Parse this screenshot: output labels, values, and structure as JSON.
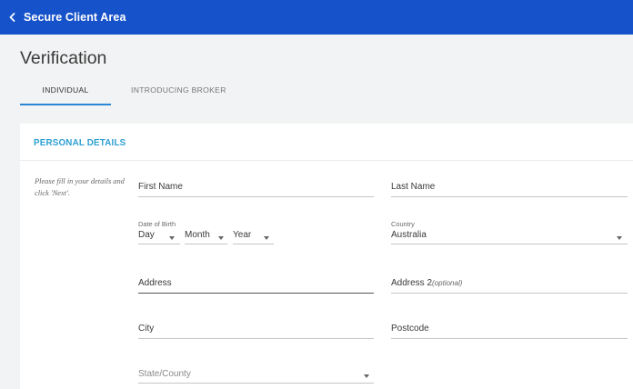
{
  "header": {
    "back_label": "Secure Client Area"
  },
  "page": {
    "title": "Verification"
  },
  "tabs": [
    {
      "label": "INDIVIDUAL",
      "active": true
    },
    {
      "label": "INTRODUCING BROKER",
      "active": false
    }
  ],
  "section": {
    "title": "PERSONAL DETAILS",
    "hint": "Please fill in your details and click 'Next'."
  },
  "form": {
    "first_name": {
      "label": "First Name"
    },
    "last_name": {
      "label": "Last Name"
    },
    "date_of_birth": {
      "label": "Date of Birth",
      "day": "Day",
      "month": "Month",
      "year": "Year"
    },
    "country": {
      "label": "Country",
      "value": "Australia"
    },
    "address": {
      "label": "Address"
    },
    "address2": {
      "label": "Address 2",
      "suffix": "(optional)"
    },
    "city": {
      "label": "City"
    },
    "postcode": {
      "label": "Postcode"
    },
    "state": {
      "label": "State/County"
    }
  },
  "colors": {
    "header_bg": "#1652c9",
    "accent": "#2d9fd2",
    "tab_indicator": "#2a86d6"
  }
}
